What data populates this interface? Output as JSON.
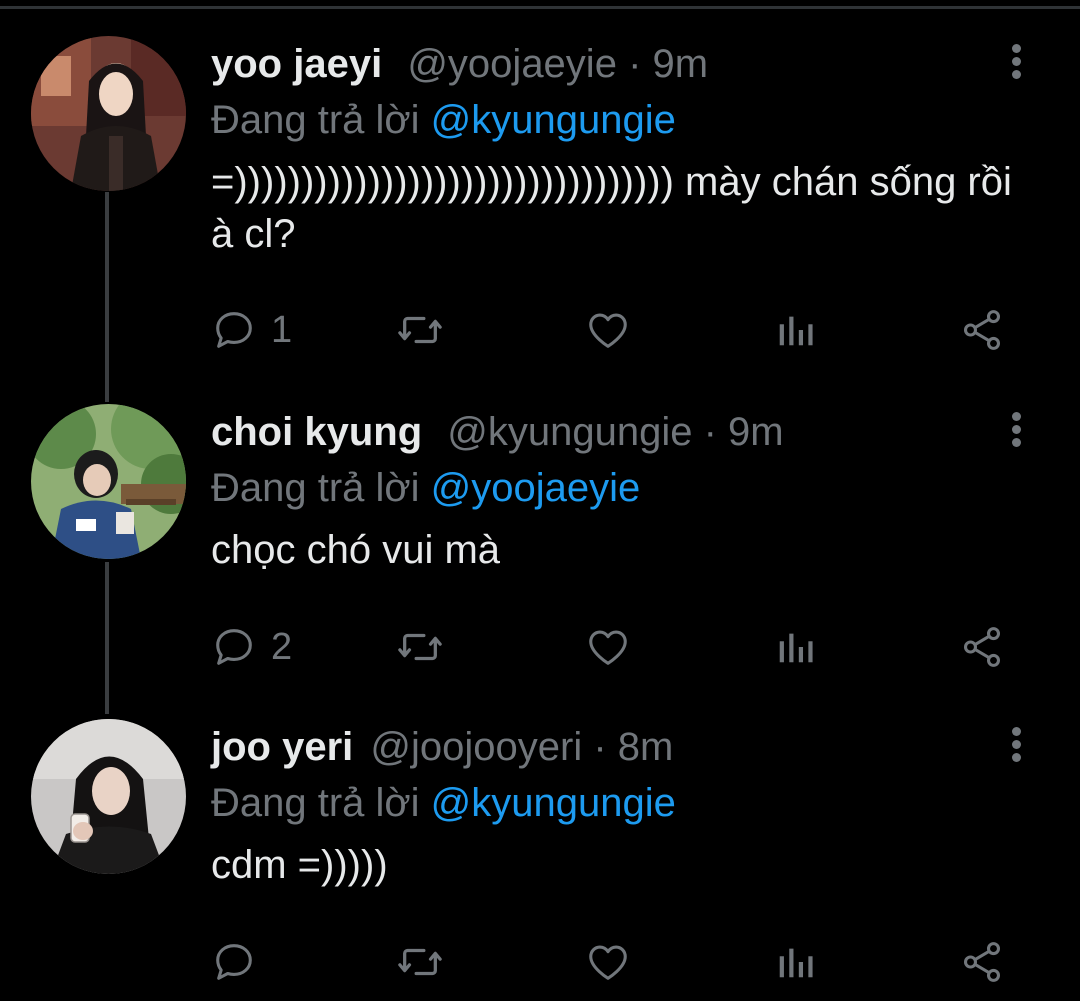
{
  "colors": {
    "background": "#000000",
    "primary_text": "#e7e9ea",
    "secondary_text": "#71767b",
    "accent": "#1d9bf0",
    "thread_line": "#3a3d40"
  },
  "tweets": [
    {
      "name": "yoo jaeyi",
      "handle": "@yoojaeyie",
      "separator": "·",
      "time": "9m",
      "reply_prefix": "Đang trả lời",
      "reply_to": "@kyungungie",
      "text": "=))))))))))))))))))))))))))))))))) mày chán sống rồi à cl?",
      "reply_count": "1",
      "icons": [
        "reply-icon",
        "retweet-icon",
        "like-icon",
        "analytics-icon",
        "share-icon"
      ]
    },
    {
      "name": "choi kyung",
      "handle": "@kyungungie",
      "separator": "·",
      "time": "9m",
      "reply_prefix": "Đang trả lời",
      "reply_to": "@yoojaeyie",
      "text": "chọc chó vui mà",
      "reply_count": "2",
      "icons": [
        "reply-icon",
        "retweet-icon",
        "like-icon",
        "analytics-icon",
        "share-icon"
      ]
    },
    {
      "name": "joo yeri",
      "handle": "@joojooyeri",
      "separator": "·",
      "time": "8m",
      "reply_prefix": "Đang trả lời",
      "reply_to": "@kyungungie",
      "text": "cdm =)))))",
      "reply_count": "",
      "icons": [
        "reply-icon",
        "retweet-icon",
        "like-icon",
        "analytics-icon",
        "share-icon"
      ]
    }
  ]
}
